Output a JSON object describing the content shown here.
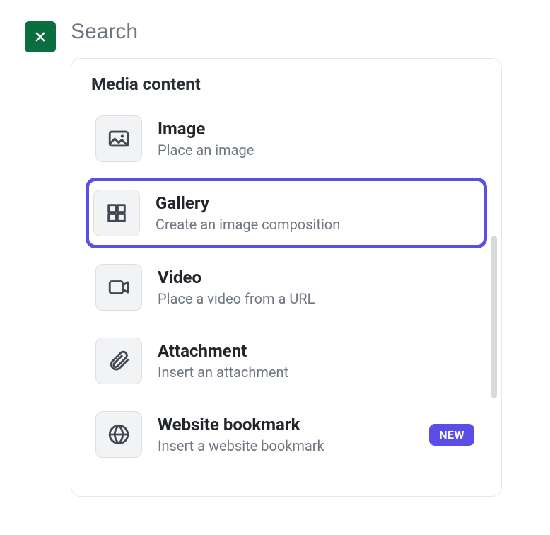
{
  "search": {
    "placeholder": "Search"
  },
  "section": {
    "title": "Media content"
  },
  "items": [
    {
      "title": "Image",
      "desc": "Place an image",
      "highlighted": false,
      "badge": null
    },
    {
      "title": "Gallery",
      "desc": "Create an image composition",
      "highlighted": true,
      "badge": null
    },
    {
      "title": "Video",
      "desc": "Place a video from a URL",
      "highlighted": false,
      "badge": null
    },
    {
      "title": "Attachment",
      "desc": "Insert an attachment",
      "highlighted": false,
      "badge": null
    },
    {
      "title": "Website bookmark",
      "desc": "Insert a website bookmark",
      "highlighted": false,
      "badge": "NEW"
    }
  ]
}
